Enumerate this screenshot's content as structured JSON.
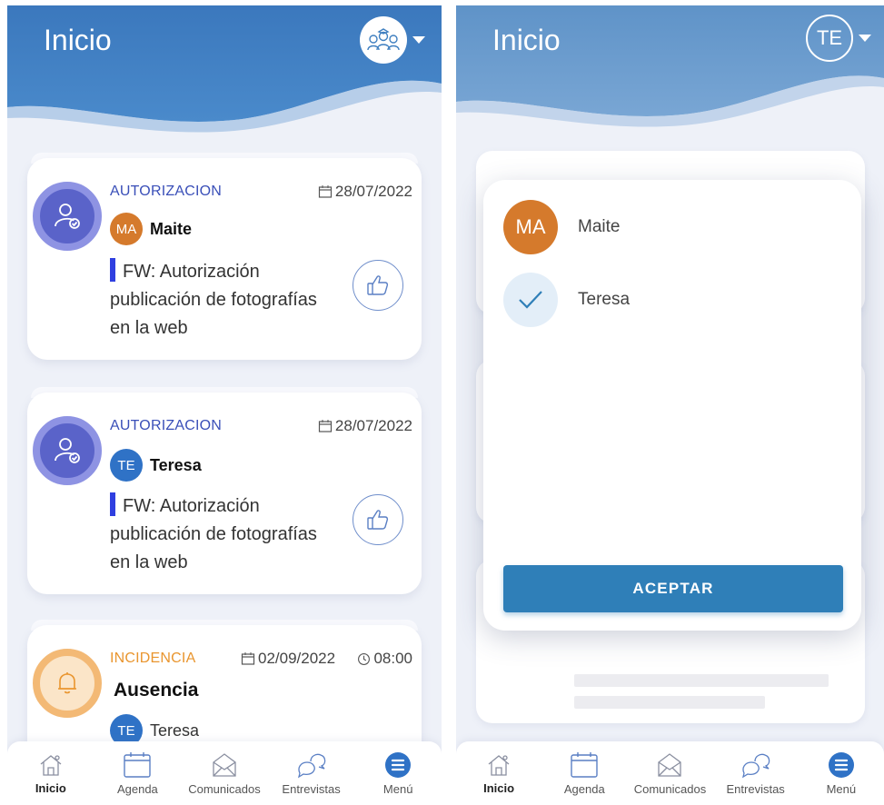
{
  "left_screen": {
    "header": {
      "title": "Inicio"
    },
    "cards": [
      {
        "type": "AUTORIZACION",
        "date": "28/07/2022",
        "person_initials": "MA",
        "person_name": "Maite",
        "text": "FW: Autorización publicación de fotografías en la web"
      },
      {
        "type": "AUTORIZACION",
        "date": "28/07/2022",
        "person_initials": "TE",
        "person_name": "Teresa",
        "text": "FW: Autorización publicación de fotografías en la web"
      },
      {
        "type": "INCIDENCIA",
        "date": "02/09/2022",
        "time": "08:00",
        "title": "Ausencia",
        "person_initials": "TE",
        "person_name": "Teresa"
      }
    ]
  },
  "right_screen": {
    "header": {
      "title": "Inicio",
      "avatar_initials": "TE"
    },
    "selector": {
      "options": [
        {
          "initials": "MA",
          "label": "Maite",
          "selected": false
        },
        {
          "label": "Teresa",
          "selected": true
        }
      ],
      "accept_label": "ACEPTAR"
    }
  },
  "bottom_nav": {
    "items": [
      {
        "label": "Inicio",
        "icon": "home-icon",
        "active": true
      },
      {
        "label": "Agenda",
        "icon": "calendar-icon"
      },
      {
        "label": "Comunicados",
        "icon": "envelope-icon"
      },
      {
        "label": "Entrevistas",
        "icon": "chat-bubbles-icon"
      },
      {
        "label": "Menú",
        "icon": "menu-icon"
      }
    ]
  },
  "colors": {
    "header_blue": "#3f7fc0",
    "accent_blue": "#2f7fb8",
    "autorizacion": "#3a4fb8",
    "incidencia": "#e9952e",
    "avatar_maite": "#d57a2c",
    "avatar_teresa": "#2f72c6"
  }
}
